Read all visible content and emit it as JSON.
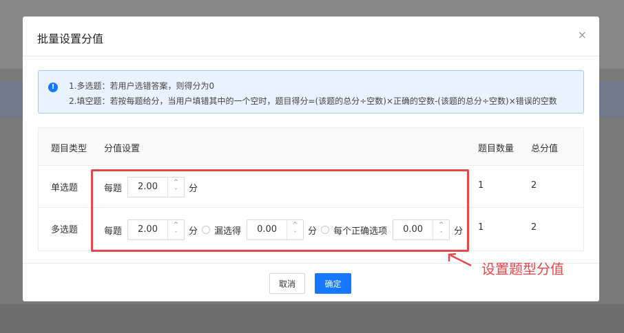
{
  "dialog": {
    "title": "批量设置分值",
    "close_glyph": "×"
  },
  "notice": {
    "icon": "info-icon",
    "icon_glyph": "!",
    "line1": "1.多选题：若用户选错答案，则得分为0",
    "line2": "2.填空题：若按每题给分，当用户填错其中的一个空时，题目得分=(该题的总分÷空数)×正确的空数-(该题的总分÷空数)×错误的空数"
  },
  "table": {
    "headers": [
      "题目类型",
      "分值设置",
      "题目数量",
      "总分值"
    ],
    "rows": [
      {
        "type": "单选题",
        "per_label": "每题",
        "per_value": "2.00",
        "unit": "分",
        "count": "1",
        "total": "2"
      },
      {
        "type": "多选题",
        "per_label": "每题",
        "per_value": "2.00",
        "unit": "分",
        "missed_label": "漏选得",
        "missed_value": "0.00",
        "missed_unit": "分",
        "correct_label": "每个正确选项",
        "correct_value": "0.00",
        "correct_unit": "分",
        "count": "1",
        "total": "2"
      }
    ]
  },
  "stepper": {
    "up": "^",
    "down": "ˇ"
  },
  "footer": {
    "cancel_label": "取消",
    "ok_label": "确定"
  },
  "annotation": {
    "text": "设置题型分值",
    "color": "#e5484d"
  },
  "colors": {
    "primary": "#1677ff",
    "alert_bg": "#e9f3ff",
    "alert_border": "#9ec9ff"
  }
}
